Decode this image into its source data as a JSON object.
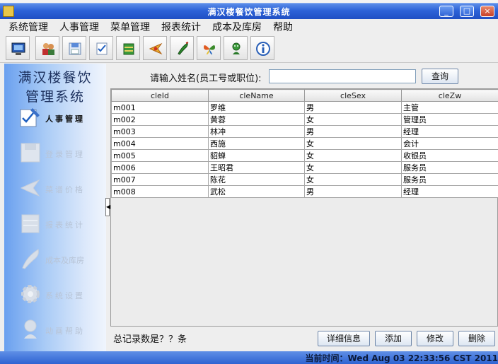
{
  "window": {
    "title": "满汉楼餐饮管理系统",
    "controls": [
      "_",
      "□",
      "×"
    ]
  },
  "menu": [
    "系统管理",
    "人事管理",
    "菜单管理",
    "报表统计",
    "成本及库房",
    "帮助"
  ],
  "toolbar_icons": [
    "monitor-icon",
    "users-icon",
    "floppy-disk-icon",
    "checklist-icon",
    "book-icon",
    "shuttlecock-icon",
    "chili-icon",
    "butterfly-icon",
    "character-icon",
    "info-icon"
  ],
  "sidebar": {
    "title_line1": "满汉楼餐饮",
    "title_line2": "管理系统",
    "items": [
      {
        "label": "人事管理",
        "icon": "pen-checklist-icon",
        "active": true
      },
      {
        "label": "登录管理",
        "icon": "floppy-disk-icon",
        "active": false
      },
      {
        "label": "菜谱价格",
        "icon": "shuttlecock-icon",
        "active": false
      },
      {
        "label": "报表统计",
        "icon": "book-icon",
        "active": false
      },
      {
        "label": "成本及库房",
        "icon": "feather-icon",
        "active": false
      },
      {
        "label": "系统设置",
        "icon": "gear-icon",
        "active": false
      },
      {
        "label": "动画帮助",
        "icon": "character-icon",
        "active": false
      }
    ]
  },
  "search": {
    "label": "请输入姓名(员工号或职位):",
    "value": "",
    "button": "查询"
  },
  "table": {
    "columns": [
      "cleId",
      "cleName",
      "cleSex",
      "cleZw"
    ],
    "rows": [
      [
        "m001",
        "罗维",
        "男",
        "主管"
      ],
      [
        "m002",
        "黄蓉",
        "女",
        "管理员"
      ],
      [
        "m003",
        "林冲",
        "男",
        "经理"
      ],
      [
        "m004",
        "西施",
        "女",
        "会计"
      ],
      [
        "m005",
        "貂蝉",
        "女",
        "收银员"
      ],
      [
        "m006",
        "王昭君",
        "女",
        "服务员"
      ],
      [
        "m007",
        "陈花",
        "女",
        "服务员"
      ],
      [
        "m008",
        "武松",
        "男",
        "经理"
      ]
    ]
  },
  "footer": {
    "record_count": "总记录数是？？条",
    "buttons": {
      "details": "详细信息",
      "add": "添加",
      "edit": "修改",
      "delete": "删除"
    }
  },
  "status": {
    "text": "当前时间：Wed Aug 03 22:33:56 CST 2011"
  }
}
